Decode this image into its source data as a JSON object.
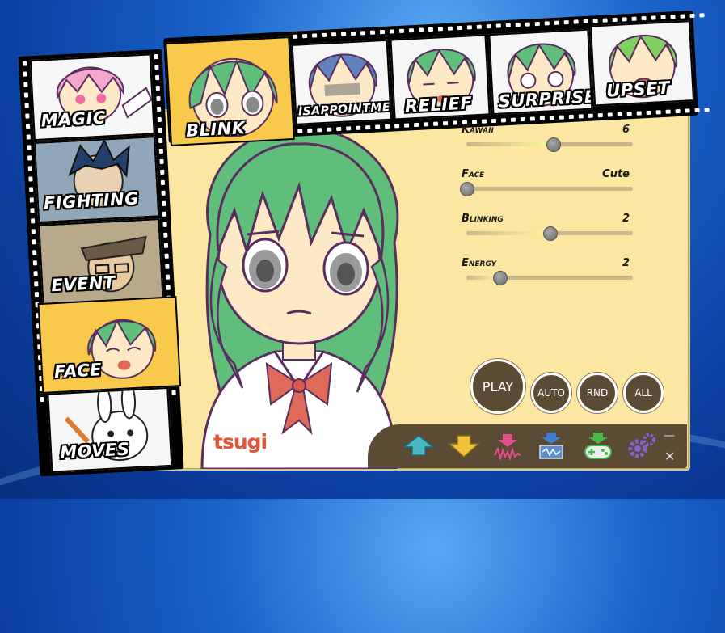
{
  "brand": {
    "logo_text": "tsugi"
  },
  "categories": [
    {
      "label": "Magic",
      "selected": false
    },
    {
      "label": "Fighting",
      "selected": false
    },
    {
      "label": "Event",
      "selected": false
    },
    {
      "label": "Face",
      "selected": true
    },
    {
      "label": "Moves",
      "selected": false
    }
  ],
  "expressions": [
    {
      "label": "Blink",
      "selected": true
    },
    {
      "label": "isappointment",
      "selected": false
    },
    {
      "label": "Relief",
      "selected": false
    },
    {
      "label": "Surprise",
      "selected": false
    },
    {
      "label": "Upset",
      "selected": false
    }
  ],
  "sliders": [
    {
      "name": "Kawaii",
      "value": "6",
      "fraction": 0.52
    },
    {
      "name": "Face",
      "value": "Cute",
      "fraction": 0.0
    },
    {
      "name": "Blinking",
      "value": "2",
      "fraction": 0.5
    },
    {
      "name": "Energy",
      "value": "2",
      "fraction": 0.2
    }
  ],
  "buttons": {
    "play": "PLAY",
    "auto": "AUTO",
    "rnd": "RND",
    "all": "ALL"
  },
  "toolbar_icons": [
    "upload-arrow-icon",
    "download-arrow-icon",
    "waveform-icon",
    "save-sound-icon",
    "gamepad-icon",
    "settings-gears-icon"
  ],
  "window_controls": {
    "minimize": "—",
    "close": "✕"
  },
  "colors": {
    "panel": "#fce7a2",
    "button": "#5b4a34",
    "hair": "#5fbf7a",
    "selected_frame": "#f8c94a"
  }
}
